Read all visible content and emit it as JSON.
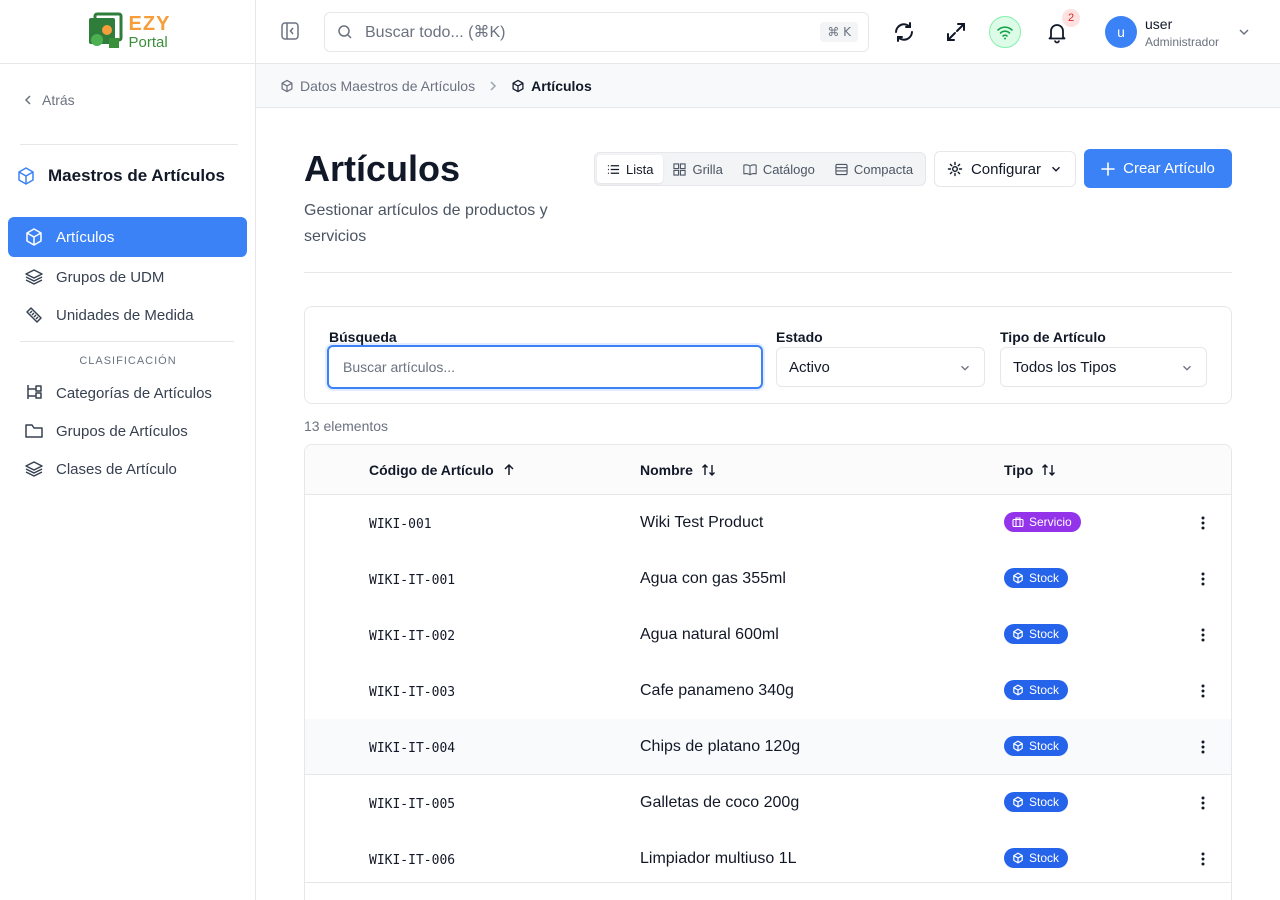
{
  "brand": {
    "name_top": "EZY",
    "name_bottom": "Portal",
    "colors": {
      "accent": "#3b82f6",
      "service": "#9333ea",
      "stock": "#2563eb"
    }
  },
  "sidebar": {
    "back_label": "Atrás",
    "section_title": "Maestros de Artículos",
    "items": [
      {
        "label": "Artículos",
        "icon": "box-icon",
        "active": true
      },
      {
        "label": "Grupos de UDM",
        "icon": "layers-icon",
        "active": false
      },
      {
        "label": "Unidades de Medida",
        "icon": "ruler-icon",
        "active": false
      }
    ],
    "caption": "CLASIFICACIÓN",
    "items2": [
      {
        "label": "Categorías de Artículos",
        "icon": "tree-icon"
      },
      {
        "label": "Grupos de Artículos",
        "icon": "folder-icon"
      },
      {
        "label": "Clases de Artículo",
        "icon": "layers-icon"
      }
    ]
  },
  "topbar": {
    "search_placeholder": "Buscar todo... (⌘K)",
    "shortcut": "⌘ K",
    "notifications_count": "2",
    "user": {
      "initial": "u",
      "name": "user",
      "role": "Administrador"
    }
  },
  "breadcrumb": {
    "parent": "Datos Maestros de Artículos",
    "current": "Artículos"
  },
  "page": {
    "title": "Artículos",
    "subtitle": "Gestionar artículos de productos y servicios",
    "views": [
      {
        "label": "Lista",
        "icon": "list-icon",
        "active": true
      },
      {
        "label": "Grilla",
        "icon": "grid-icon",
        "active": false
      },
      {
        "label": "Catálogo",
        "icon": "book-icon",
        "active": false
      },
      {
        "label": "Compacta",
        "icon": "rows-icon",
        "active": false
      }
    ],
    "configure_label": "Configurar",
    "create_label": "Crear Artículo"
  },
  "filters": {
    "search_label": "Búsqueda",
    "search_placeholder": "Buscar artículos...",
    "status_label": "Estado",
    "status_value": "Activo",
    "type_label": "Tipo de Artículo",
    "type_value": "Todos los Tipos"
  },
  "table": {
    "count_label": "13 elementos",
    "columns": {
      "code": "Código de Artículo",
      "name": "Nombre",
      "type": "Tipo"
    },
    "rows": [
      {
        "code": "WIKI-001",
        "name": "Wiki Test Product",
        "type": "Servicio",
        "kind": "svc"
      },
      {
        "code": "WIKI-IT-001",
        "name": "Agua con gas 355ml",
        "type": "Stock",
        "kind": "stk"
      },
      {
        "code": "WIKI-IT-002",
        "name": "Agua natural 600ml",
        "type": "Stock",
        "kind": "stk"
      },
      {
        "code": "WIKI-IT-003",
        "name": "Cafe panameno 340g",
        "type": "Stock",
        "kind": "stk"
      },
      {
        "code": "WIKI-IT-004",
        "name": "Chips de platano 120g",
        "type": "Stock",
        "kind": "stk"
      },
      {
        "code": "WIKI-IT-005",
        "name": "Galletas de coco 200g",
        "type": "Stock",
        "kind": "stk"
      },
      {
        "code": "WIKI-IT-006",
        "name": "Limpiador multiuso 1L",
        "type": "Stock",
        "kind": "stk"
      }
    ]
  }
}
